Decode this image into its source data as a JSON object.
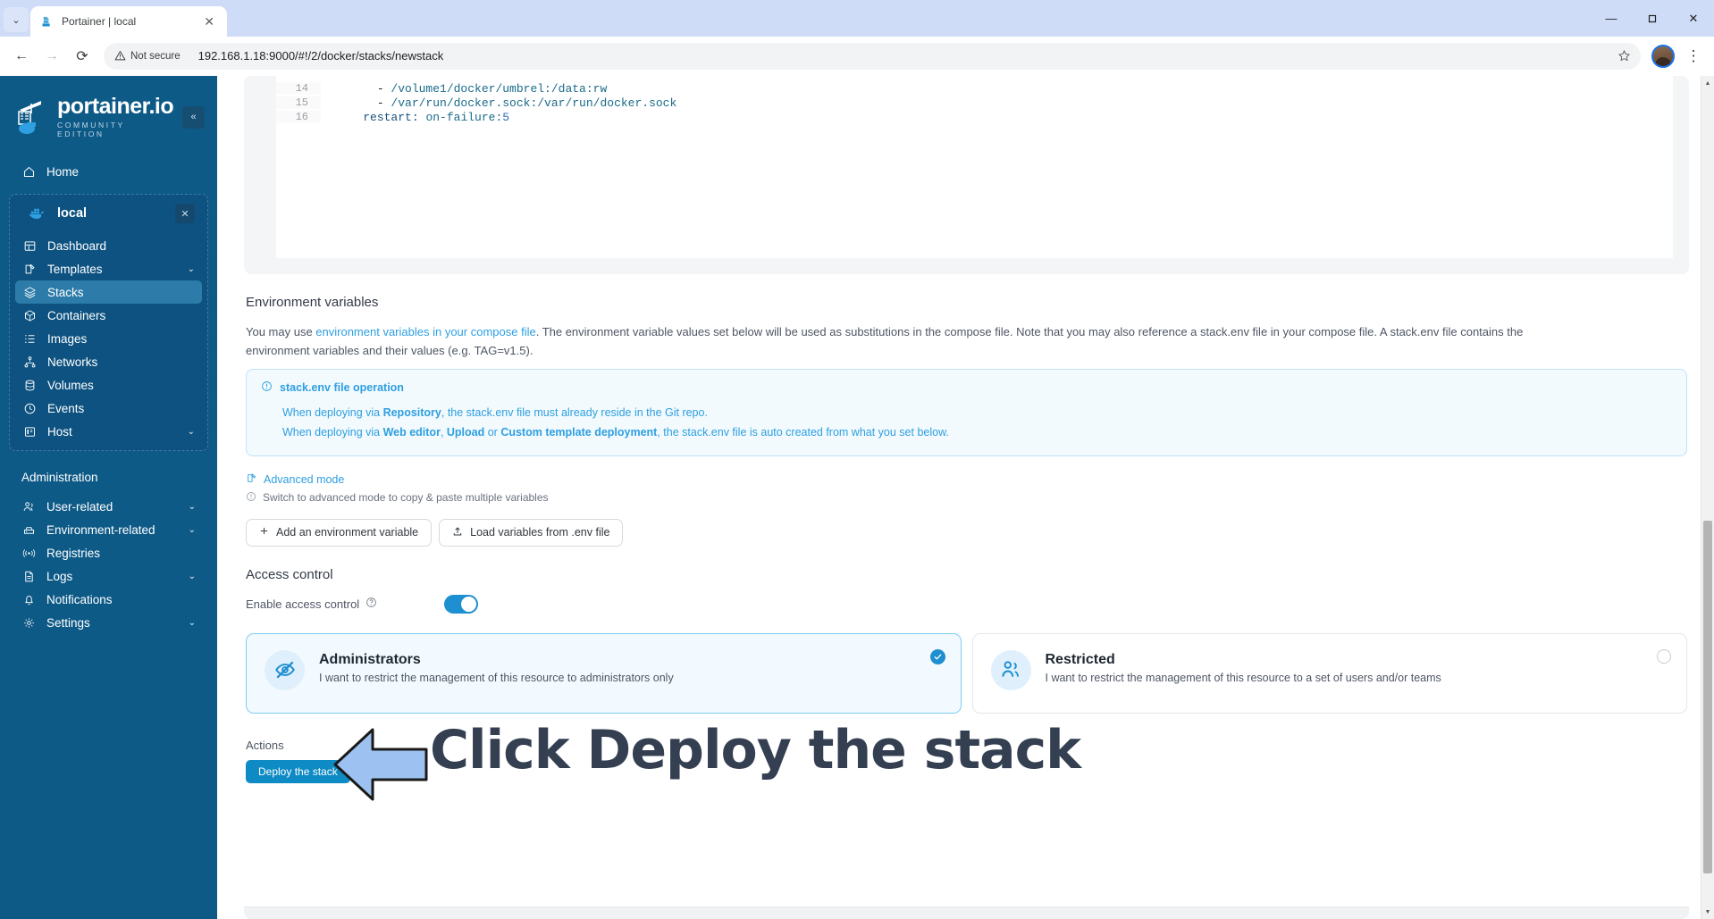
{
  "browser": {
    "tab": {
      "title": "Portainer | local",
      "favicon": "portainer-favicon",
      "close_label": "✕"
    },
    "tabstrip_chevron": "⌄",
    "window_controls": {
      "minimize": "—",
      "maximize": "❐",
      "close": "✕"
    },
    "nav": {
      "back": "←",
      "forward": "→",
      "reload": "⟳"
    },
    "security": {
      "label": "Not secure",
      "icon": "warning-triangle-icon"
    },
    "url": "192.168.1.18:9000/#!/2/docker/stacks/newstack",
    "star": "☆",
    "menu": "⋮"
  },
  "sidebar": {
    "brand": {
      "name": "portainer.io",
      "subtitle": "COMMUNITY EDITION",
      "logo": "portainer-crane-logo"
    },
    "collapse": "«",
    "home": {
      "label": "Home",
      "icon": "home-icon"
    },
    "environment": {
      "name": "local",
      "icon": "docker-whale-icon",
      "close": "✕"
    },
    "env_items": [
      {
        "label": "Dashboard",
        "icon": "dashboard-icon",
        "chevron": "",
        "active": false
      },
      {
        "label": "Templates",
        "icon": "templates-icon",
        "chevron": "⌄",
        "active": false
      },
      {
        "label": "Stacks",
        "icon": "stacks-icon",
        "chevron": "",
        "active": true
      },
      {
        "label": "Containers",
        "icon": "containers-icon",
        "chevron": "",
        "active": false
      },
      {
        "label": "Images",
        "icon": "images-icon",
        "chevron": "",
        "active": false
      },
      {
        "label": "Networks",
        "icon": "networks-icon",
        "chevron": "",
        "active": false
      },
      {
        "label": "Volumes",
        "icon": "volumes-icon",
        "chevron": "",
        "active": false
      },
      {
        "label": "Events",
        "icon": "events-clock-icon",
        "chevron": "",
        "active": false
      },
      {
        "label": "Host",
        "icon": "host-icon",
        "chevron": "⌄",
        "active": false
      }
    ],
    "admin_title": "Administration",
    "admin_items": [
      {
        "label": "User-related",
        "icon": "users-icon",
        "chevron": "⌄"
      },
      {
        "label": "Environment-related",
        "icon": "environment-icon",
        "chevron": "⌄"
      },
      {
        "label": "Registries",
        "icon": "registries-icon",
        "chevron": ""
      },
      {
        "label": "Logs",
        "icon": "logs-icon",
        "chevron": "⌄"
      },
      {
        "label": "Notifications",
        "icon": "bell-icon",
        "chevron": ""
      },
      {
        "label": "Settings",
        "icon": "gear-icon",
        "chevron": "⌄"
      }
    ]
  },
  "editor": {
    "lines": [
      {
        "number": "14",
        "indent": "      ",
        "dash": "- ",
        "text": "/volume1/docker/umbrel:/data:rw"
      },
      {
        "number": "15",
        "indent": "      ",
        "dash": "- ",
        "text": "/var/run/docker.sock:/var/run/docker.sock"
      },
      {
        "number": "16",
        "indent": "    ",
        "dash": "",
        "key": "restart: ",
        "value": "on-failure:",
        "num": "5"
      }
    ]
  },
  "env_section": {
    "title": "Environment variables",
    "para_1": "You may use ",
    "para_link": "environment variables in your compose file",
    "para_2": ". The environment variable values set below will be used as substitutions in the compose file. Note that you may also reference a stack.env file in your compose file. A stack.env file contains the environment variables and their values (e.g. TAG=v1.5).",
    "info": {
      "icon": "info-circle-icon",
      "title": "stack.env file operation",
      "line1_a": "When deploying via ",
      "line1_b": "Repository",
      "line1_c": ", the stack.env file must already reside in the Git repo.",
      "line2_a": "When deploying via ",
      "line2_b": "Web editor",
      "line2_c": ", ",
      "line2_d": "Upload",
      "line2_e": " or ",
      "line2_f": "Custom template deployment",
      "line2_g": ", the stack.env file is auto created from what you set below."
    },
    "advanced_mode": {
      "label": "Advanced mode",
      "icon": "edit-square-icon"
    },
    "advanced_hint": {
      "label": "Switch to advanced mode to copy & paste multiple variables",
      "icon": "info-circle-icon"
    },
    "buttons": [
      {
        "label": "Add an environment variable",
        "icon": "plus-icon"
      },
      {
        "label": "Load variables from .env file",
        "icon": "upload-icon"
      }
    ]
  },
  "access_control": {
    "title": "Access control",
    "enable_label": "Enable access control",
    "help_icon": "question-circle-icon",
    "toggle_on": true,
    "options": [
      {
        "title": "Administrators",
        "description": "I want to restrict the management of this resource to administrators only",
        "icon": "eye-off-icon",
        "selected": true
      },
      {
        "title": "Restricted",
        "description": "I want to restrict the management of this resource to a set of users and/or teams",
        "icon": "users-group-icon",
        "selected": false
      }
    ]
  },
  "actions": {
    "title": "Actions",
    "deploy_label": "Deploy the stack"
  },
  "annotation": {
    "text": "Click Deploy the stack",
    "arrow": "left-arrow-annotation",
    "arrow_fill": "#9dc1f0",
    "arrow_stroke": "#1a1a1a",
    "text_color": "#343f52"
  },
  "colors": {
    "sidebar_bg": "#0e5a87",
    "sidebar_active": "#2c7ba8",
    "accent_blue": "#2e9fe0",
    "deploy_blue": "#0e8ac4",
    "card_selected_bg": "#f2faff",
    "card_selected_border": "#7fcdf2"
  }
}
